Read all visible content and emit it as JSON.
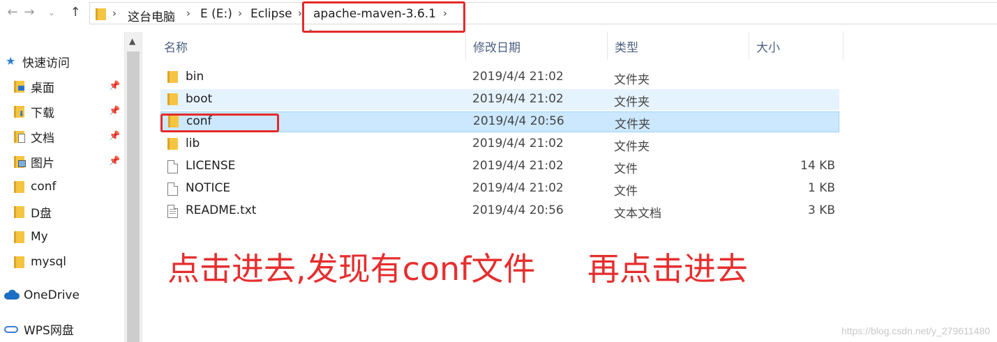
{
  "nav": {
    "back_icon": "arrow-left-icon",
    "forward_icon": "arrow-right-icon",
    "recent_icon": "chevron-down-icon",
    "up_icon": "arrow-up-icon"
  },
  "breadcrumb": [
    "这台电脑",
    "E (E:)",
    "Eclipse",
    "apache-maven-3.6.1"
  ],
  "sidebar": {
    "quick_access": "快速访问",
    "items": [
      {
        "label": "桌面",
        "pinned": true
      },
      {
        "label": "下载",
        "pinned": true
      },
      {
        "label": "文档",
        "pinned": true
      },
      {
        "label": "图片",
        "pinned": true
      },
      {
        "label": "conf",
        "pinned": false
      },
      {
        "label": "D盘",
        "pinned": false
      },
      {
        "label": "My",
        "pinned": false
      },
      {
        "label": "mysql",
        "pinned": false
      }
    ],
    "onedrive": "OneDrive",
    "wps": "WPS网盘"
  },
  "columns": {
    "name": "名称",
    "date": "修改日期",
    "type": "类型",
    "size": "大小"
  },
  "files": [
    {
      "name": "bin",
      "date": "2019/4/4 21:02",
      "type": "文件夹",
      "size": "",
      "kind": "folder"
    },
    {
      "name": "boot",
      "date": "2019/4/4 21:02",
      "type": "文件夹",
      "size": "",
      "kind": "folder"
    },
    {
      "name": "conf",
      "date": "2019/4/4 20:56",
      "type": "文件夹",
      "size": "",
      "kind": "folder"
    },
    {
      "name": "lib",
      "date": "2019/4/4 21:02",
      "type": "文件夹",
      "size": "",
      "kind": "folder"
    },
    {
      "name": "LICENSE",
      "date": "2019/4/4 21:02",
      "type": "文件",
      "size": "14 KB",
      "kind": "file"
    },
    {
      "name": "NOTICE",
      "date": "2019/4/4 21:02",
      "type": "文件",
      "size": "1 KB",
      "kind": "file"
    },
    {
      "name": "README.txt",
      "date": "2019/4/4 20:56",
      "type": "文本文档",
      "size": "3 KB",
      "kind": "txt"
    }
  ],
  "annotation": {
    "left": "点击进去,发现有conf文件",
    "right": "再点击进去"
  },
  "watermark": "https://blog.csdn.net/y_279611480",
  "colors": {
    "highlight": "#e32a2a",
    "selected_row": "#cce8ff",
    "hover_row": "#e5f3ff",
    "folder": "#f5c542"
  }
}
